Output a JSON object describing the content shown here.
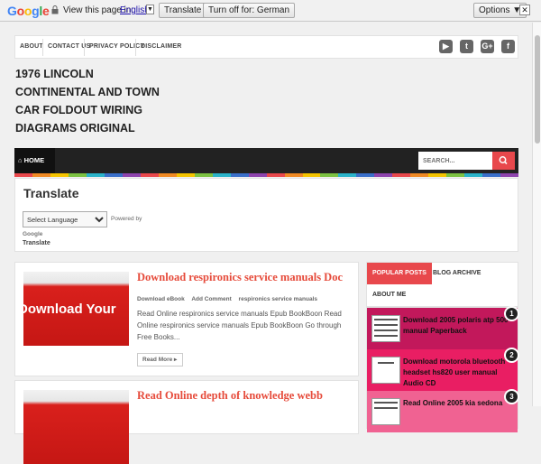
{
  "translate_bar": {
    "logo": "Google",
    "view_text": "View this page in:",
    "language": "English",
    "translate_button": "Translate",
    "turn_off_button": "Turn off for: German",
    "options_button": "Options ▼",
    "close": "✕"
  },
  "top_nav": [
    "ABOUT",
    "CONTACT US",
    "PRIVACY POLICY",
    "DISCLAIMER"
  ],
  "social_icons": [
    "youtube-icon",
    "twitter-icon",
    "google-plus-icon",
    "facebook-icon"
  ],
  "site_title": "1976 LINCOLN CONTINENTAL AND TOWN CAR FOLDOUT WIRING DIAGRAMS ORIGINAL",
  "main_nav": {
    "home": "HOME",
    "search_placeholder": "SEARCH..."
  },
  "stripe_colors": [
    "#e8484c",
    "#f08a24",
    "#f5c400",
    "#7cc242",
    "#2ab3c9",
    "#3a6fc9",
    "#8e44ad",
    "#e8484c",
    "#f08a24",
    "#f5c400",
    "#7cc242",
    "#2ab3c9",
    "#3a6fc9",
    "#8e44ad",
    "#e8484c",
    "#f08a24",
    "#f5c400",
    "#7cc242",
    "#2ab3c9",
    "#3a6fc9",
    "#8e44ad",
    "#e8484c",
    "#f08a24",
    "#f5c400",
    "#7cc242",
    "#2ab3c9",
    "#3a6fc9",
    "#8e44ad"
  ],
  "translate_widget": {
    "title": "Translate",
    "select_value": "Select Language",
    "powered_by": "Powered by",
    "google": "Google",
    "translate": "Translate"
  },
  "posts": [
    {
      "thumb_text": "Download Your",
      "title": "Download respironics service manuals Doc",
      "meta": [
        "Download eBook",
        "Add Comment",
        "respironics service manuals"
      ],
      "excerpt": "Read Online respironics service manuals Epub BookBoon Read Online respironics service manuals Epub BookBoon Go through Free Books...",
      "read_more": "Read More ▸"
    },
    {
      "title": "Read Online depth of knowledge webb"
    }
  ],
  "sidebar": {
    "tabs": [
      "POPULAR POSTS",
      "BLOG ARCHIVE",
      "ABOUT ME"
    ],
    "popular": [
      {
        "title": "Download 2005 polaris atp 500 manual Paperback",
        "num": "1",
        "bg": "#c2185b"
      },
      {
        "title": "Download motorola bluetooth headset hs820 user manual Audio CD",
        "num": "2",
        "bg": "#e91e63"
      },
      {
        "title": "Read Online 2005 kia sedona",
        "num": "3",
        "bg": "#f06292"
      }
    ]
  },
  "colors": {
    "accent": "#e8484c",
    "nav_dark": "#222222",
    "title_red": "#e64b3b"
  }
}
